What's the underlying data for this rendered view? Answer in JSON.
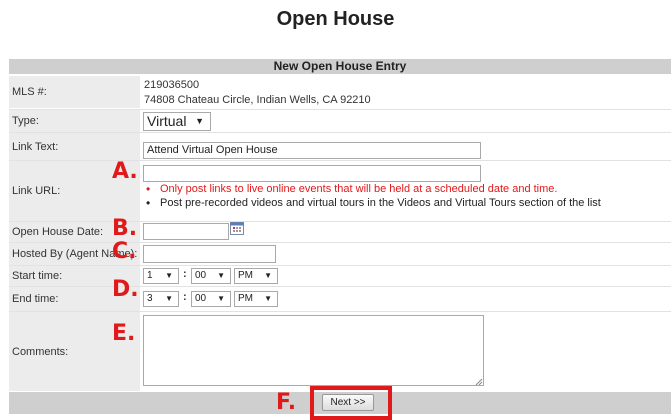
{
  "page_title": "Open House",
  "form_header": "New Open House Entry",
  "mls": {
    "label": "MLS #:",
    "number": "219036500",
    "address": "74808 Chateau Circle, Indian Wells, CA 92210"
  },
  "type": {
    "label": "Type:",
    "value": "Virtual"
  },
  "link_text": {
    "label": "Link Text:",
    "value": "Attend Virtual Open House"
  },
  "link_url": {
    "label": "Link URL:",
    "value": "",
    "notes": [
      "Only post links to live online events that will be held at a scheduled date and time.",
      "Post pre-recorded videos and virtual tours in the Videos and Virtual Tours section of the list"
    ]
  },
  "open_house_date": {
    "label": "Open House Date:",
    "value": ""
  },
  "hosted_by": {
    "label": "Hosted By (Agent Name):",
    "value": ""
  },
  "start_time": {
    "label": "Start time:",
    "hour": "1",
    "separator": ":",
    "minute": "00",
    "ampm": "PM"
  },
  "end_time": {
    "label": "End time:",
    "hour": "3",
    "separator": ":",
    "minute": "00",
    "ampm": "PM"
  },
  "comments": {
    "label": "Comments:",
    "value": ""
  },
  "next_button": "Next >>",
  "markers": [
    "A.",
    "B.",
    "C.",
    "D.",
    "E.",
    "F."
  ],
  "colors": {
    "header_bg": "#cfcfcf",
    "label_bg": "#ececec",
    "marker_red": "#e0191b",
    "warning_red": "#e0191b"
  },
  "icons": {
    "calendar": "calendar-icon",
    "dropdown": "dropdown-arrow-icon",
    "resize": "resize-grip-icon"
  }
}
